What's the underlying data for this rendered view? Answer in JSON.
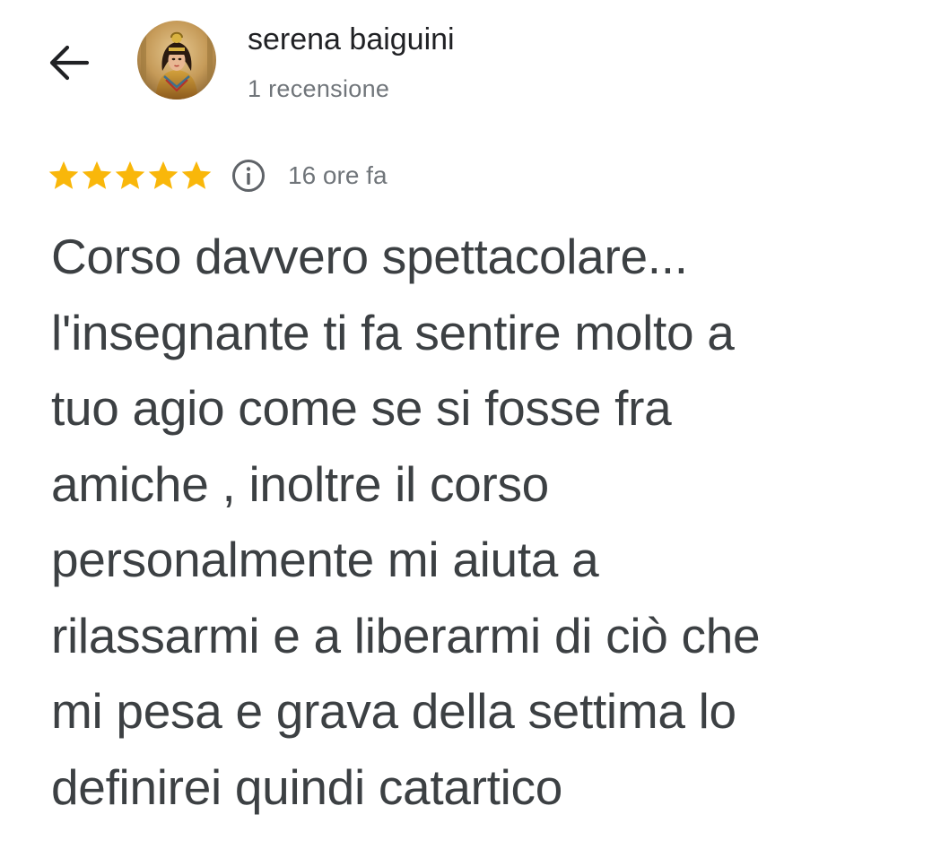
{
  "header": {
    "back_icon": "arrow-left-icon",
    "avatar_icon": "profile-photo",
    "reviewer_name": "serena baiguini",
    "review_count": "1 recensione"
  },
  "review": {
    "rating": 5,
    "rating_max": 5,
    "star_color": "#f9b70a",
    "info_icon": "info-icon",
    "time_ago": "16 ore fa",
    "text_lines": [
      "Corso davvero spettacolare...",
      "l'insegnante ti fa sentire molto a",
      "tuo agio come se si fosse fra",
      "amiche , inoltre il corso",
      "personalmente mi aiuta a",
      "rilassarmi e a liberarmi di ciò che",
      "mi pesa e grava della settima lo",
      "definirei quindi catartico"
    ]
  }
}
